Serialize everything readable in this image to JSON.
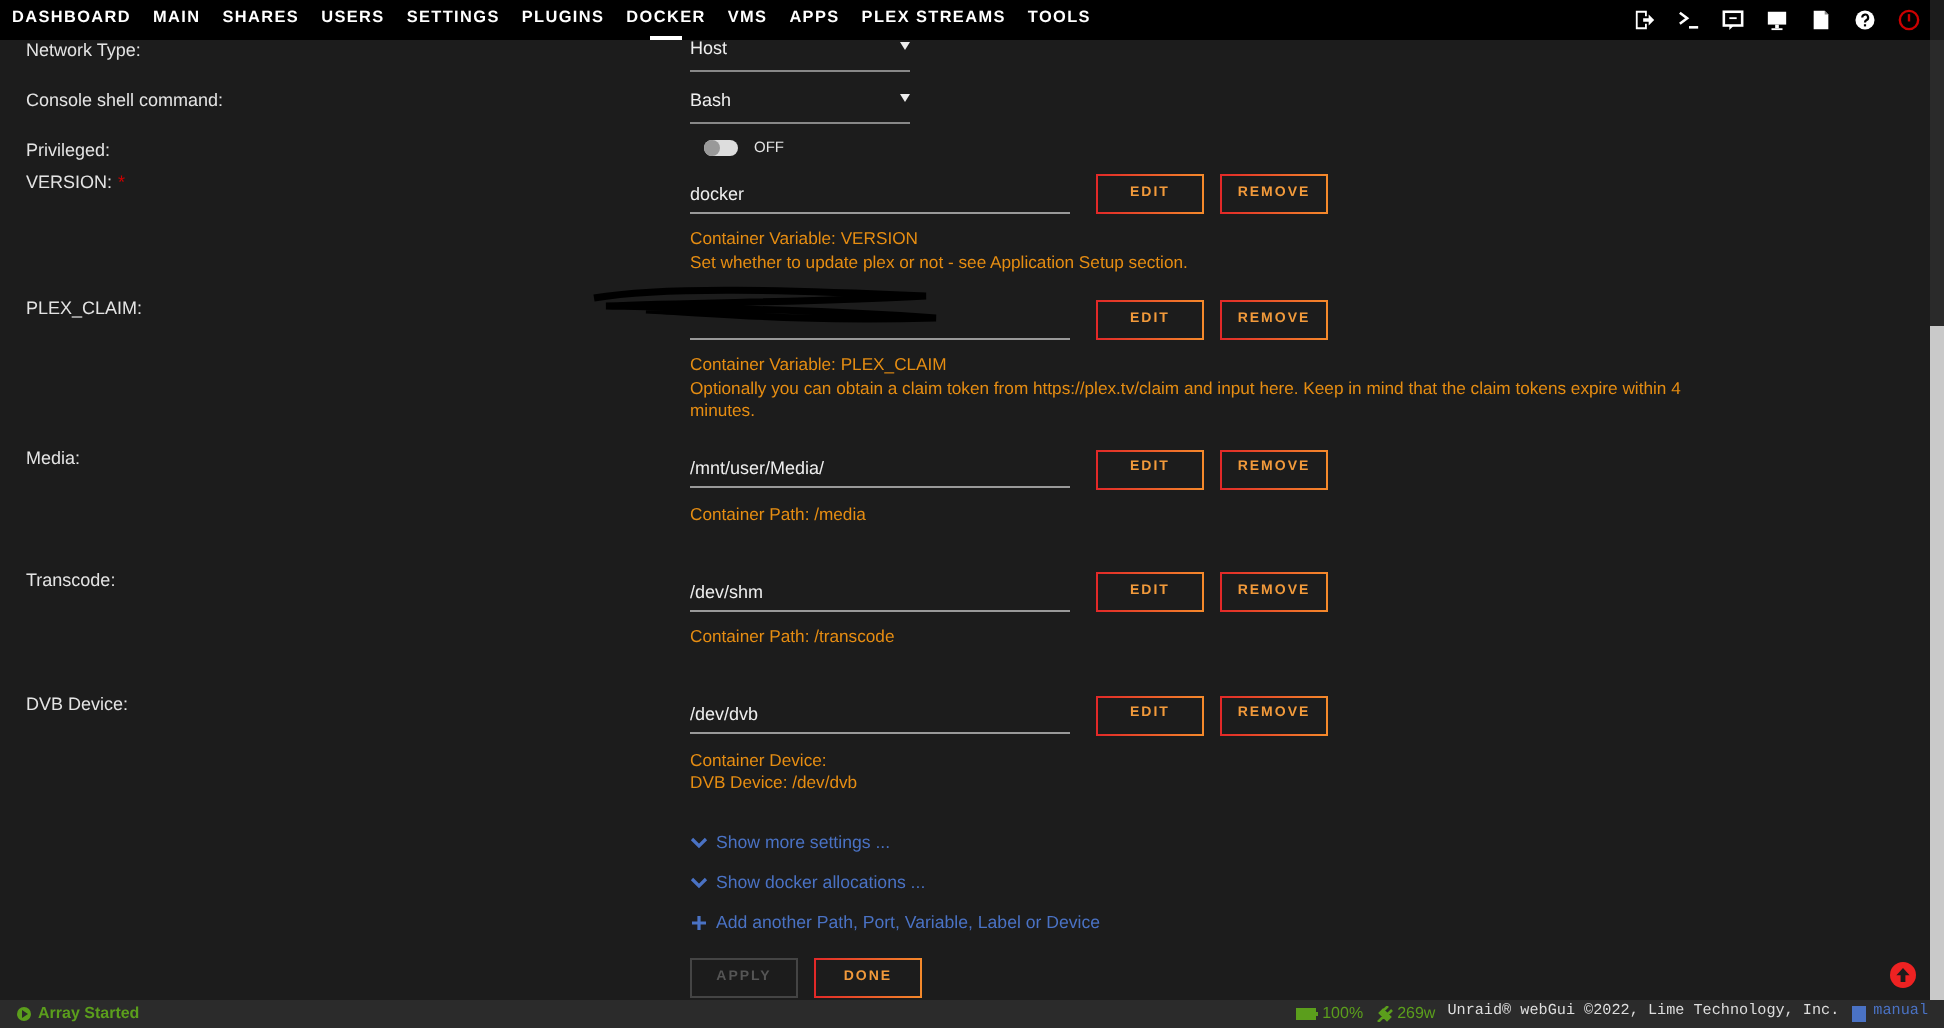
{
  "nav": {
    "items": [
      {
        "label": "DASHBOARD",
        "selected": false
      },
      {
        "label": "MAIN",
        "selected": false
      },
      {
        "label": "SHARES",
        "selected": false
      },
      {
        "label": "USERS",
        "selected": false
      },
      {
        "label": "SETTINGS",
        "selected": false
      },
      {
        "label": "PLUGINS",
        "selected": false
      },
      {
        "label": "DOCKER",
        "selected": true
      },
      {
        "label": "VMS",
        "selected": false
      },
      {
        "label": "APPS",
        "selected": false
      },
      {
        "label": "PLEX STREAMS",
        "selected": false
      },
      {
        "label": "TOOLS",
        "selected": false
      }
    ]
  },
  "settings": [
    {
      "kind": "select",
      "label": "Network Type:",
      "value": "Host"
    },
    {
      "kind": "select",
      "label": "Console shell command:",
      "value": "Bash"
    },
    {
      "kind": "toggle",
      "label": "Privileged:",
      "on": false,
      "state_text": "OFF"
    },
    {
      "kind": "config",
      "label": "VERSION:",
      "required_mark": "*",
      "value": "docker",
      "buttons": [
        "EDIT",
        "REMOVE"
      ],
      "notes": [
        "Container Variable: VERSION",
        "Set whether to update plex or not - see Application Setup section."
      ]
    },
    {
      "kind": "config",
      "label": "PLEX_CLAIM:",
      "redacted": true,
      "buttons": [
        "EDIT",
        "REMOVE"
      ],
      "notes": [
        "Container Variable: PLEX_CLAIM",
        "Optionally you can obtain a claim token from https://plex.tv/claim and input here. Keep in mind that the claim tokens expire within 4 minutes."
      ]
    },
    {
      "kind": "config",
      "label": "Media:",
      "value": "/mnt/user/Media/",
      "buttons": [
        "EDIT",
        "REMOVE"
      ],
      "notes": [
        "Container Path: /media"
      ]
    },
    {
      "kind": "config",
      "label": "Transcode:",
      "value": "/dev/shm",
      "buttons": [
        "EDIT",
        "REMOVE"
      ],
      "notes": [
        "Container Path: /transcode"
      ]
    },
    {
      "kind": "config",
      "label": "DVB Device:",
      "value": "/dev/dvb",
      "buttons": [
        "EDIT",
        "REMOVE"
      ],
      "notes": [
        "Container Device:",
        "DVB Device: /dev/dvb"
      ]
    }
  ],
  "links": [
    {
      "kind": "expand",
      "text": "Show more settings ..."
    },
    {
      "kind": "expand",
      "text": "Show docker allocations ..."
    },
    {
      "kind": "add",
      "text": "Add another Path, Port, Variable, Label or Device"
    }
  ],
  "actions": [
    {
      "label": "APPLY",
      "disabled": true
    },
    {
      "label": "DONE",
      "disabled": false
    }
  ],
  "status_bar": {
    "array": "Array Started",
    "battery": "100%",
    "power": "269w",
    "copyright": "Unraid® webGui ©2022, Lime Technology, Inc.",
    "manual": "manual"
  }
}
